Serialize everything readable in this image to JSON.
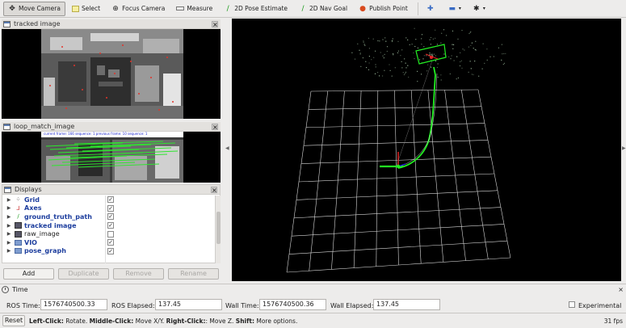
{
  "toolbar": {
    "tools": [
      {
        "label": "Move Camera",
        "icon": "move-camera-icon",
        "active": true
      },
      {
        "label": "Select",
        "icon": "select-icon",
        "active": false
      },
      {
        "label": "Focus Camera",
        "icon": "focus-camera-icon",
        "active": false
      },
      {
        "label": "Measure",
        "icon": "measure-icon",
        "active": false
      },
      {
        "label": "2D Pose Estimate",
        "icon": "pose-estimate-icon",
        "active": false
      },
      {
        "label": "2D Nav Goal",
        "icon": "nav-goal-icon",
        "active": false
      },
      {
        "label": "Publish Point",
        "icon": "publish-point-icon",
        "active": false
      }
    ]
  },
  "panels": {
    "tracked_image": {
      "title": "tracked image"
    },
    "loop_match": {
      "title": "loop_match_image",
      "overlay_text": "current frame: 166   sequence: 1        previous frame: 10   sequence: 1"
    }
  },
  "displays": {
    "title": "Displays",
    "items": [
      {
        "label": "Grid",
        "icon": "grid-icon",
        "checked": true,
        "bold": true
      },
      {
        "label": "Axes",
        "icon": "axes-icon",
        "checked": true,
        "bold": true
      },
      {
        "label": "ground_truth_path",
        "icon": "path-icon",
        "checked": true,
        "bold": true
      },
      {
        "label": "tracked image",
        "icon": "image-icon",
        "checked": true,
        "bold": true
      },
      {
        "label": "raw_image",
        "icon": "image-icon",
        "checked": false,
        "bold": false
      },
      {
        "label": "VIO",
        "icon": "folder-icon",
        "checked": true,
        "bold": true
      },
      {
        "label": "pose_graph",
        "icon": "folder-icon",
        "checked": true,
        "bold": true
      }
    ],
    "buttons": {
      "add": "Add",
      "duplicate": "Duplicate",
      "remove": "Remove",
      "rename": "Rename"
    }
  },
  "time": {
    "title": "Time",
    "ros_time_label": "ROS Time:",
    "ros_time": "1576740500.33",
    "ros_elapsed_label": "ROS Elapsed:",
    "ros_elapsed": "137.45",
    "wall_time_label": "Wall Time:",
    "wall_time": "1576740500.36",
    "wall_elapsed_label": "Wall Elapsed:",
    "wall_elapsed": "137.45",
    "experimental_label": "Experimental"
  },
  "status": {
    "reset": "Reset",
    "left_click": "Left-Click:",
    "left_desc": " Rotate. ",
    "middle_click": "Middle-Click:",
    "middle_desc": " Move X/Y. ",
    "right_click": "Right-Click:",
    "right_desc": ": Move Z. ",
    "shift": "Shift:",
    "shift_desc": " More options.",
    "fps": "31 fps"
  },
  "colors": {
    "path_green": "#22ee22",
    "grid_white": "#d8d8d8",
    "link_blue": "#1d3e9e"
  }
}
